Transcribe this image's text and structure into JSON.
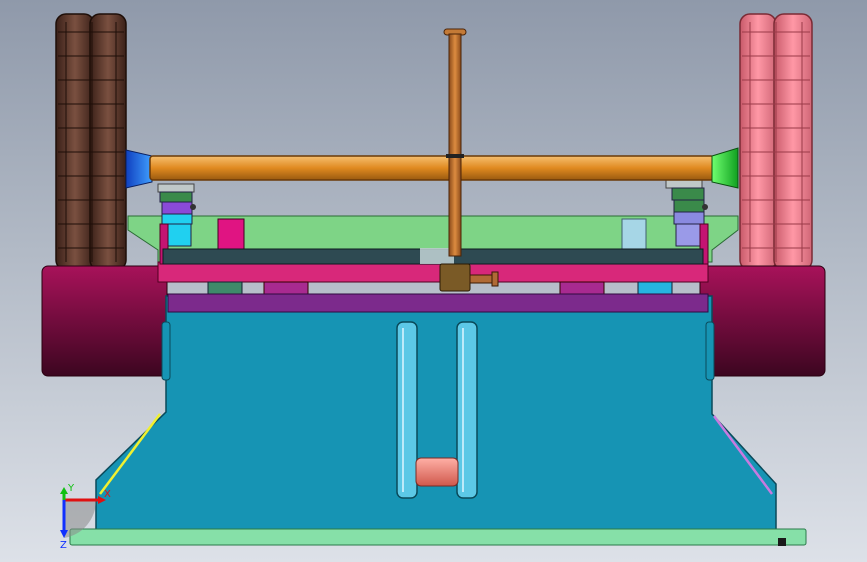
{
  "viewport": {
    "background_top": "#8f99aa",
    "background_bottom": "#dde1e8"
  },
  "colors": {
    "left_wheel": "#5e3a2e",
    "right_wheel": "#f08090",
    "axle": "#e8982a",
    "left_axle_cap": "#2a6ce0",
    "right_axle_cap": "#29d63a",
    "mast": "#b86a2c",
    "green_frame": "#7ed486",
    "pink_deck": "#d8287a",
    "dark_plate": "#2e4a52",
    "body": "#1694b4",
    "body_top_band": "#7c2a8c",
    "maroon_blocks": "#8a0c48",
    "base_plate": "#86e0a8",
    "slot_bar": "#5cc8e6",
    "cross_pin": "#f08478",
    "bracket_block": "#c41472",
    "sensor_block": "#a6d6e6",
    "cyan_block": "#20d0f0"
  },
  "triad": {
    "x_label": "X",
    "y_label": "Y",
    "z_label": "Z",
    "x_color": "#e01010",
    "y_color": "#10c010",
    "z_color": "#1030ff"
  }
}
